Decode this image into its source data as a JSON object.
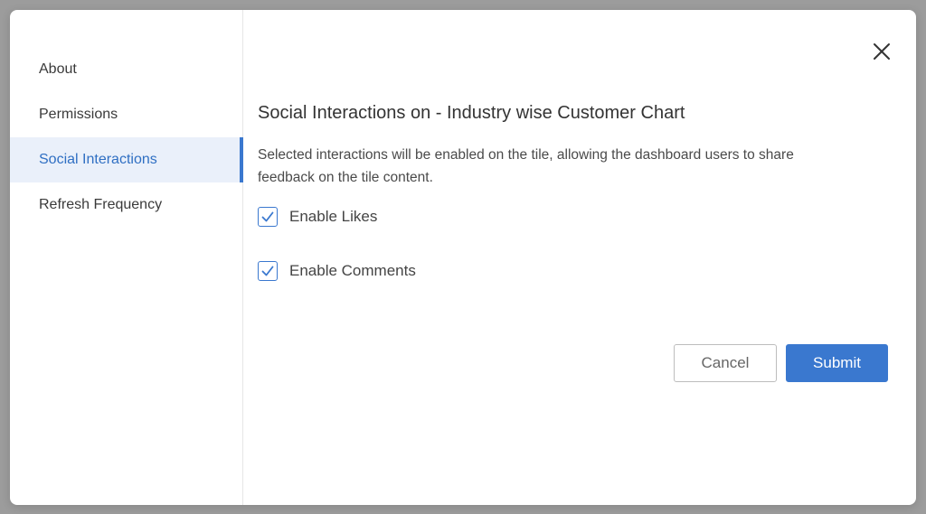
{
  "sidebar": {
    "items": [
      {
        "label": "About"
      },
      {
        "label": "Permissions"
      },
      {
        "label": "Social Interactions"
      },
      {
        "label": "Refresh Frequency"
      }
    ],
    "active_index": 2
  },
  "content": {
    "title": "Social Interactions on - Industry wise Customer Chart",
    "description": "Selected interactions will be enabled on the tile, allowing the dashboard users to share feedback on the tile content.",
    "options": [
      {
        "label": "Enable Likes",
        "checked": true
      },
      {
        "label": "Enable Comments",
        "checked": true
      }
    ]
  },
  "actions": {
    "cancel_label": "Cancel",
    "submit_label": "Submit"
  },
  "icons": {
    "close": "close-icon",
    "check": "checkmark-icon"
  },
  "colors": {
    "accent": "#3a78cf",
    "active_bg": "#eaf0fa",
    "overlay": "#9c9c9c"
  }
}
